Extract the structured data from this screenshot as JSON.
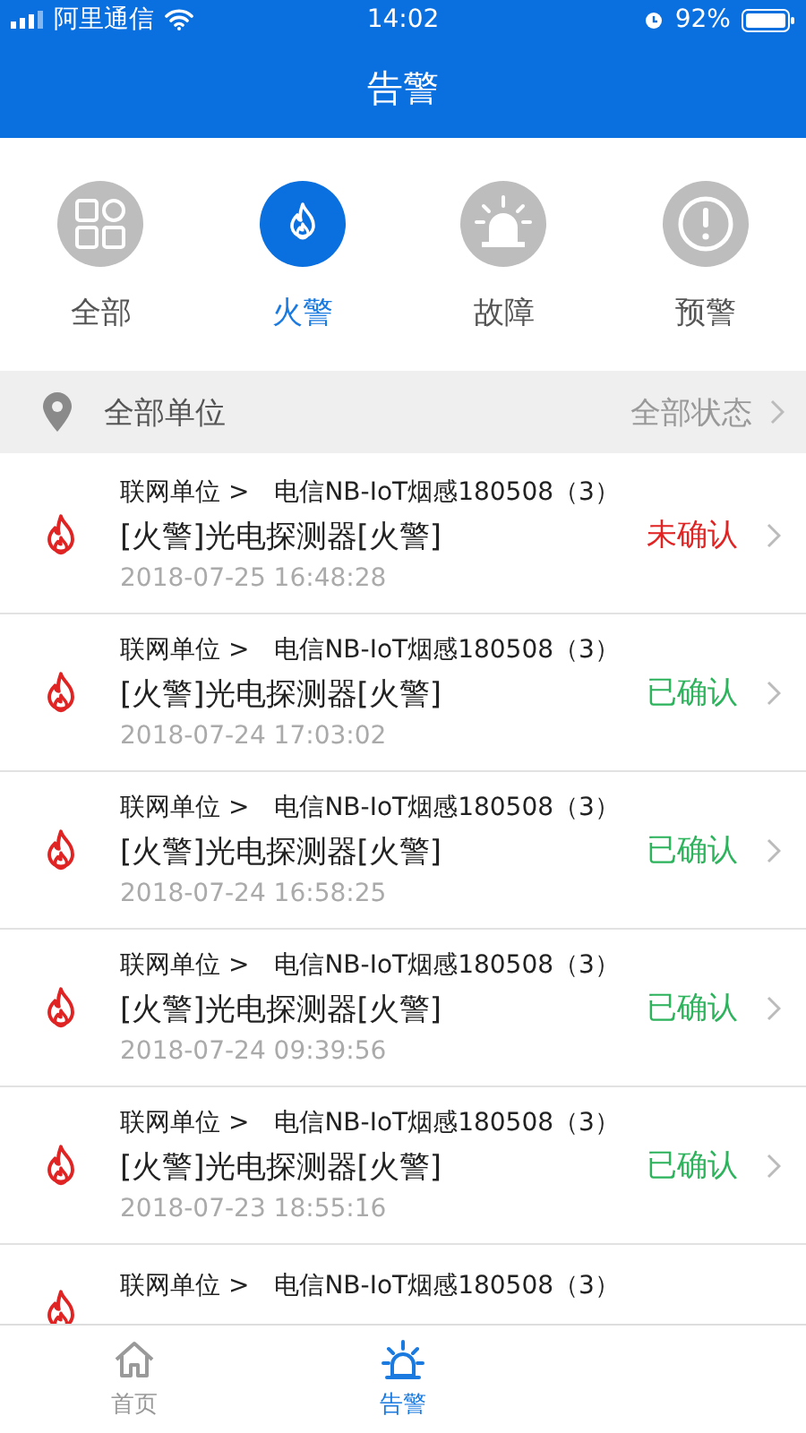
{
  "status_bar": {
    "carrier": "阿里通信",
    "time": "14:02",
    "battery": "92%"
  },
  "header": {
    "title": "告警"
  },
  "categories": [
    {
      "kind": "all",
      "label": "全部",
      "selected": false
    },
    {
      "kind": "fire",
      "label": "火警",
      "selected": true
    },
    {
      "kind": "fault",
      "label": "故障",
      "selected": false
    },
    {
      "kind": "warning",
      "label": "预警",
      "selected": false
    }
  ],
  "filter": {
    "unit": "全部单位",
    "state": "全部状态"
  },
  "alarms": [
    {
      "unit_label": "联网单位 >",
      "device": "电信NB-IoT烟感180508（3）",
      "title": "[火警]光电探测器[火警]",
      "time": "2018-07-25 16:48:28",
      "status": "未确认",
      "confirmed": false
    },
    {
      "unit_label": "联网单位 >",
      "device": "电信NB-IoT烟感180508（3）",
      "title": "[火警]光电探测器[火警]",
      "time": "2018-07-24 17:03:02",
      "status": "已确认",
      "confirmed": true
    },
    {
      "unit_label": "联网单位 >",
      "device": "电信NB-IoT烟感180508（3）",
      "title": "[火警]光电探测器[火警]",
      "time": "2018-07-24 16:58:25",
      "status": "已确认",
      "confirmed": true
    },
    {
      "unit_label": "联网单位 >",
      "device": "电信NB-IoT烟感180508（3）",
      "title": "[火警]光电探测器[火警]",
      "time": "2018-07-24 09:39:56",
      "status": "已确认",
      "confirmed": true
    },
    {
      "unit_label": "联网单位 >",
      "device": "电信NB-IoT烟感180508（3）",
      "title": "[火警]光电探测器[火警]",
      "time": "2018-07-23 18:55:16",
      "status": "已确认",
      "confirmed": true
    },
    {
      "unit_label": "联网单位 >",
      "device": "电信NB-IoT烟感180508（3）"
    }
  ],
  "tab_bar": [
    {
      "kind": "home",
      "label": "首页",
      "selected": false
    },
    {
      "kind": "alarm",
      "label": "告警",
      "selected": true
    }
  ]
}
